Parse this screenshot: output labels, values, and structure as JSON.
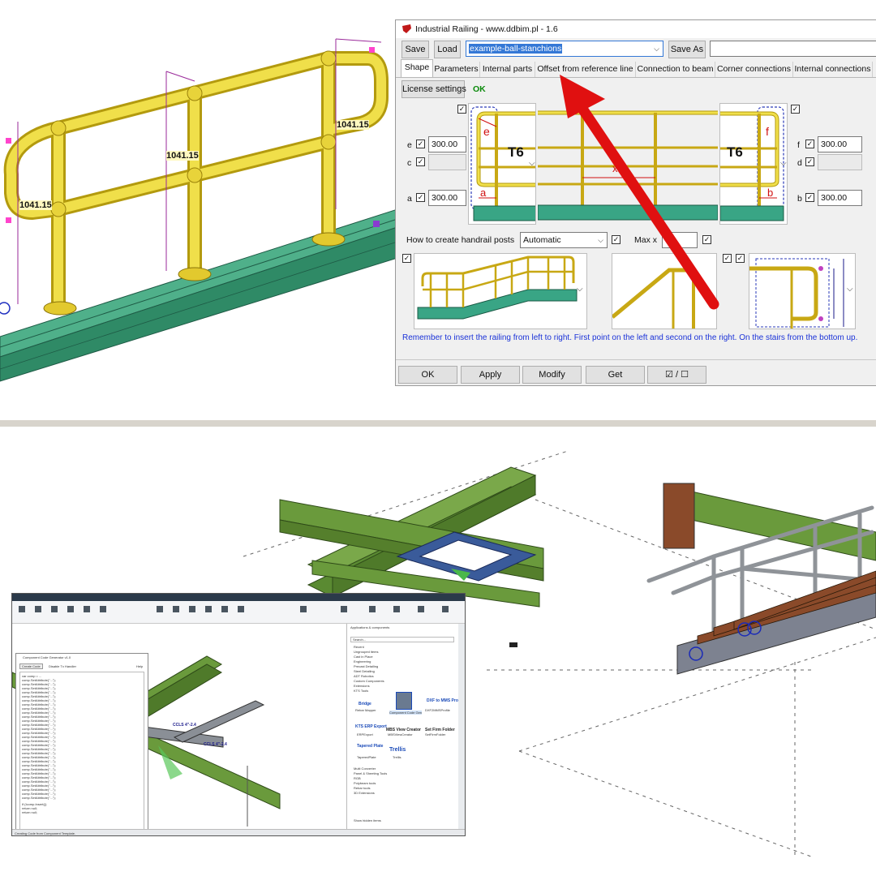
{
  "top": {
    "model": {
      "dimension_labels": [
        "1041.15",
        "1041.15",
        "1041.15"
      ]
    },
    "dialog": {
      "title": "Industrial Railing - www.ddbim.pl - 1.6",
      "save_label": "Save",
      "load_label": "Load",
      "preset_value": "example-ball-stanchions",
      "save_as_label": "Save As",
      "save_as_value": "",
      "tabs": [
        {
          "label": "Shape",
          "active": true
        },
        {
          "label": "Parameters",
          "active": false
        },
        {
          "label": "Internal parts",
          "active": false
        },
        {
          "label": "Offset from reference line",
          "active": false
        },
        {
          "label": "Connection to beam",
          "active": false
        },
        {
          "label": "Corner connections",
          "active": false
        },
        {
          "label": "Internal connections",
          "active": false
        }
      ],
      "license_label": "License settings",
      "license_status": "OK",
      "left_params": [
        {
          "name": "e",
          "value": "300.00",
          "enabled": true
        },
        {
          "name": "c",
          "value": "",
          "enabled": false
        },
        {
          "name": "a",
          "value": "300.00",
          "enabled": true
        }
      ],
      "right_params": [
        {
          "name": "f",
          "value": "300.00",
          "enabled": true
        },
        {
          "name": "d",
          "value": "",
          "enabled": false
        },
        {
          "name": "b",
          "value": "300.00",
          "enabled": true
        }
      ],
      "left_end_type": "T6",
      "right_end_type": "T6",
      "preview_letters": {
        "e": "e",
        "a": "a",
        "x": "x",
        "f": "f",
        "b": "b"
      },
      "posts_label": "How to create handrail posts",
      "posts_value": "Automatic",
      "max_x_label": "Max x",
      "max_x_value": "",
      "note": "Remember to insert the railing from left to right. First point on the left and second on the right. On the stairs from the bottom up.",
      "footer": {
        "ok": "OK",
        "apply": "Apply",
        "modify": "Modify",
        "get": "Get",
        "toggle": "☑ / ☐"
      }
    },
    "colors": {
      "railing": "#e6d23a",
      "railing_dark": "#b39a0e",
      "beam": "#3d9a7a",
      "accent_arrow": "#e01010",
      "note_text": "#1a32d8",
      "license_ok": "#0a8a0a",
      "highlight": "#3478d6"
    }
  },
  "bottom": {
    "window": {
      "dialog_title": "Component Code Generator v1.0",
      "create_code_label": "Create Code",
      "disable_label": "Disable Tx Handler",
      "help_label": "Help",
      "code_lines": [
        "var comp = ...",
        "comp.SetAttribute(\"...\");",
        "comp.SetAttribute(\"...\");",
        "comp.SetAttribute(\"...\");",
        "comp.SetAttribute(\"...\");",
        "comp.SetAttribute(\"...\");",
        "comp.SetAttribute(\"...\");",
        "comp.SetAttribute(\"...\");",
        "comp.SetAttribute(\"...\");",
        "comp.SetAttribute(\"...\");",
        "comp.SetAttribute(\"...\");",
        "comp.SetAttribute(\"...\");",
        "comp.SetAttribute(\"...\");",
        "comp.SetAttribute(\"...\");",
        "comp.SetAttribute(\"...\");",
        "comp.SetAttribute(\"...\");",
        "comp.SetAttribute(\"...\");",
        "comp.SetAttribute(\"...\");",
        "comp.SetAttribute(\"...\");",
        "comp.SetAttribute(\"...\");",
        "comp.SetAttribute(\"...\");",
        "comp.SetAttribute(\"...\");",
        "comp.SetAttribute(\"...\");",
        "comp.SetAttribute(\"...\");",
        "comp.SetAttribute(\"...\");",
        "comp.SetAttribute(\"...\");",
        "comp.SetAttribute(\"...\");",
        "comp.SetAttribute(\"...\");",
        "comp.SetAttribute(\"...\");",
        "comp.SetAttribute(\"...\");",
        "comp.SetAttribute(\"...\");",
        "if (!comp.Insert())",
        "  return null;",
        "return null;"
      ],
      "beam_labels": [
        "CCLS 4\"-2.4",
        "CCLS 4\"-2.4"
      ],
      "side_panel": {
        "title": "Applications & components",
        "search": "Search...",
        "items": [
          "Recent",
          "Ungrouped items",
          "Cast in Place",
          "Engineering",
          "Precast Detailing",
          "Steel Detailing",
          "ADT Robotics",
          "Custom Components",
          "Extensions",
          "KTS Tools"
        ],
        "apps": [
          {
            "name": "Bridge",
            "sub": "Rebar Mapper"
          },
          {
            "name": "Component Code Gen",
            "sub": "ComponentCodeGen"
          },
          {
            "name": "DXF to MMS Profile",
            "sub": "DXF2MMSProfile"
          },
          {
            "name": "KTS ERP Export",
            "sub": "ERPExport"
          },
          {
            "name": "MBS View Creator",
            "sub": "MBSViewCreator"
          },
          {
            "name": "Set Firm Folder",
            "sub": "SetFirmFolder"
          },
          {
            "name": "Tapered Plate",
            "sub": "TaperedPlate"
          },
          {
            "name": "Trellis",
            "sub": "Trellis"
          }
        ],
        "footer_items": [
          "Multi Converter",
          "Panel & Sheeting Tools",
          "RGB",
          "Polybeam tools",
          "Rebar tools",
          "3D Extensions"
        ],
        "show_hidden": "Show hidden items"
      },
      "status": "Creating Code from Component Template."
    },
    "colors": {
      "steel": "#6a9a3c",
      "steel_dark": "#3f6a22",
      "selected_frame": "#3a5b9a",
      "rail": "#9da1a6",
      "stair_tread": "#8a4a2a",
      "stair_stringer": "#7a7f8a"
    }
  }
}
